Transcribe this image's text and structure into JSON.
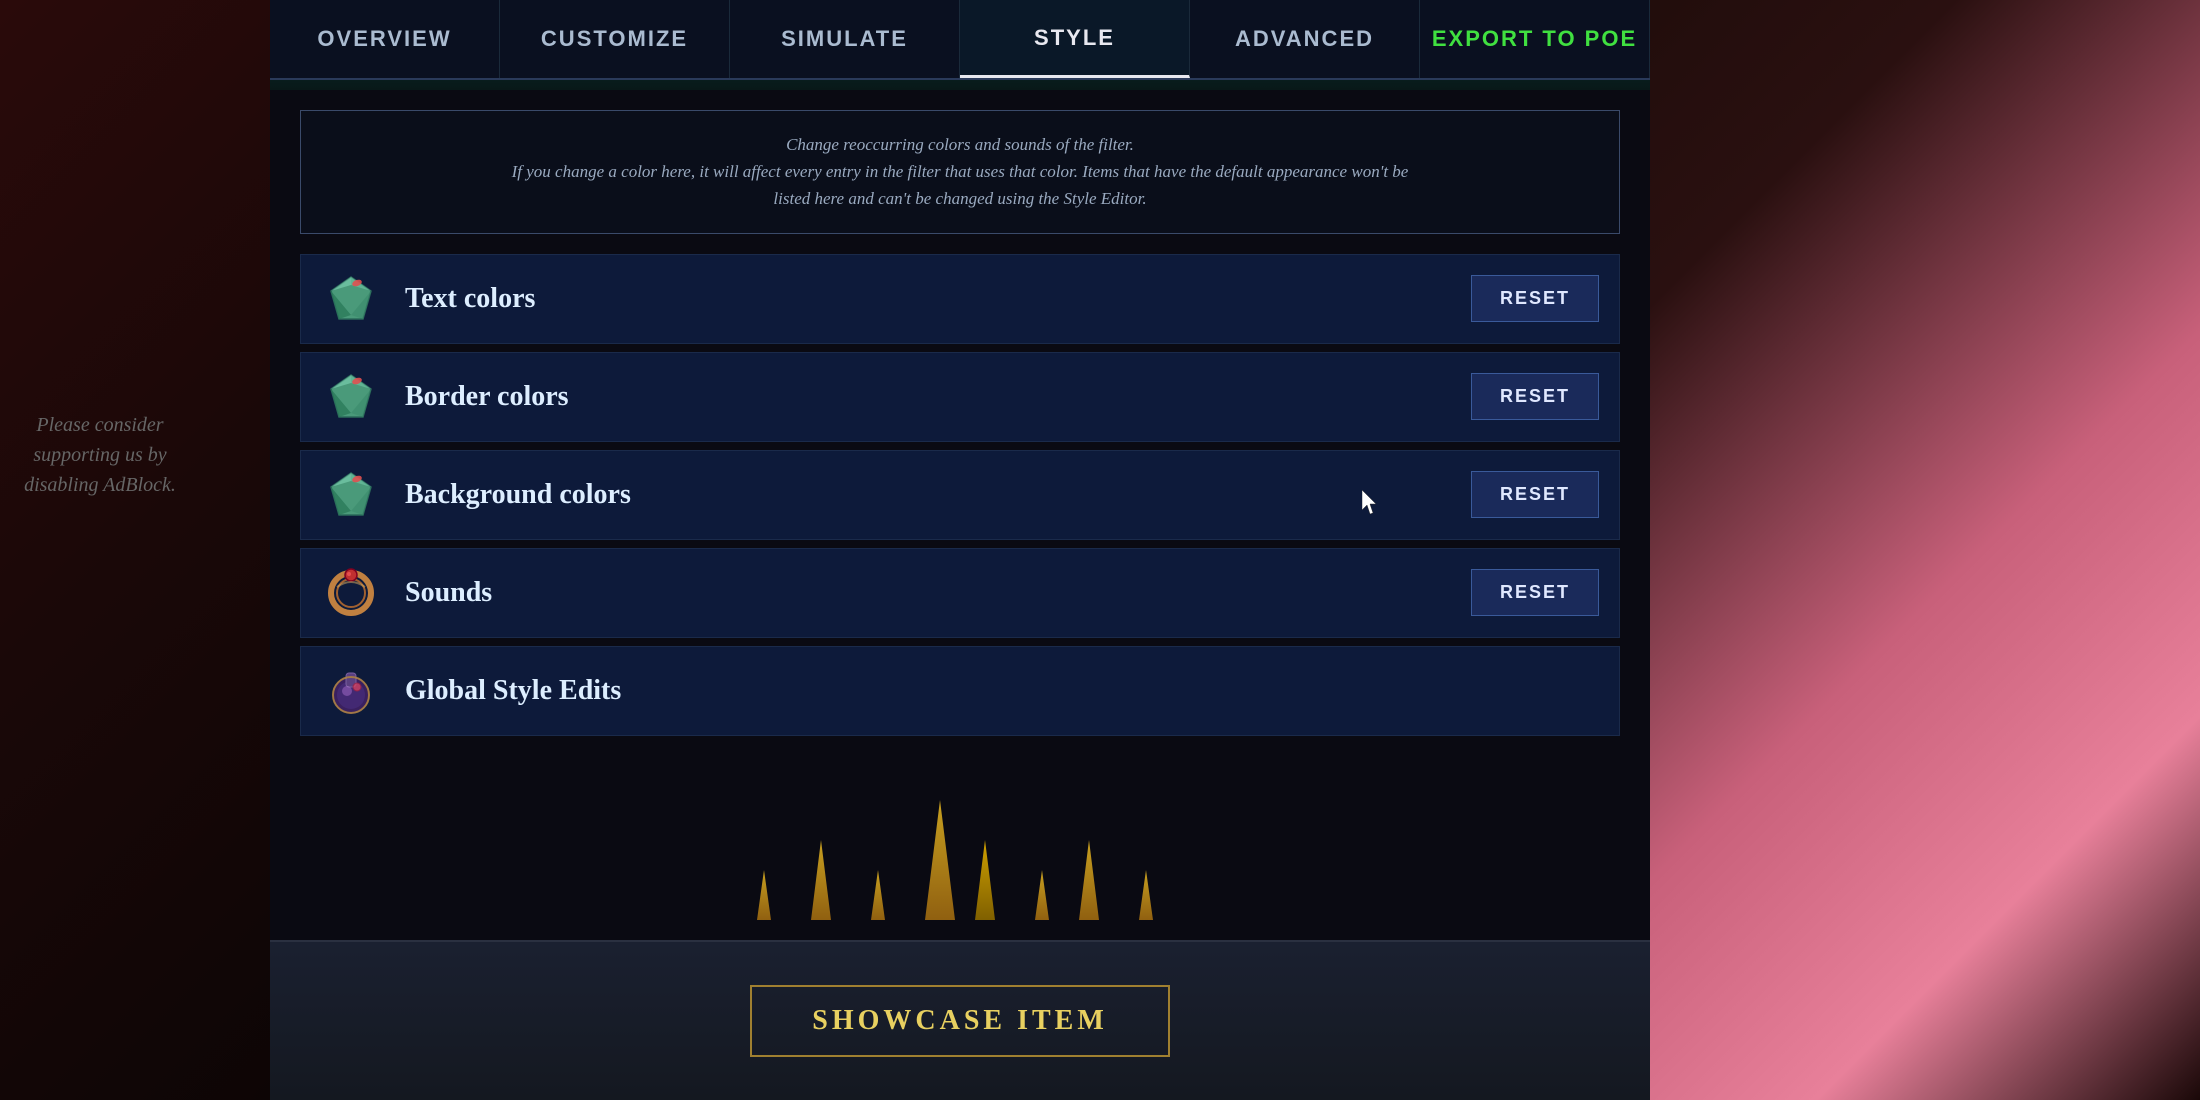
{
  "background": {
    "sidebar_text": "Please consider supporting us by disabling AdBlock."
  },
  "nav": {
    "tabs": [
      {
        "id": "overview",
        "label": "OVERVIEW",
        "active": false
      },
      {
        "id": "customize",
        "label": "CUSTOMIZE",
        "active": false
      },
      {
        "id": "simulate",
        "label": "SIMULATE",
        "active": false
      },
      {
        "id": "style",
        "label": "STYLE",
        "active": true
      },
      {
        "id": "advanced",
        "label": "ADVANCED",
        "active": false
      },
      {
        "id": "export",
        "label": "EXPORT TO POE",
        "active": false,
        "special": "export"
      }
    ]
  },
  "info": {
    "line1": "Change reoccurring colors and sounds of the filter.",
    "line2": "If you change a color here, it will affect every entry in the filter that uses that color. Items that have the default appearance won't be",
    "line3": "listed here and can't be changed using the Style Editor."
  },
  "categories": [
    {
      "id": "text-colors",
      "label": "Text colors",
      "has_reset": true,
      "reset_label": "RESET",
      "icon": "gem"
    },
    {
      "id": "border-colors",
      "label": "Border colors",
      "has_reset": true,
      "reset_label": "RESET",
      "icon": "gem"
    },
    {
      "id": "background-colors",
      "label": "Background colors",
      "has_reset": true,
      "reset_label": "RESET",
      "icon": "gem"
    },
    {
      "id": "sounds",
      "label": "Sounds",
      "has_reset": true,
      "reset_label": "RESET",
      "icon": "ring"
    },
    {
      "id": "global-style-edits",
      "label": "Global Style Edits",
      "has_reset": false,
      "icon": "orb"
    }
  ],
  "showcase": {
    "button_label": "Showcase Item"
  }
}
